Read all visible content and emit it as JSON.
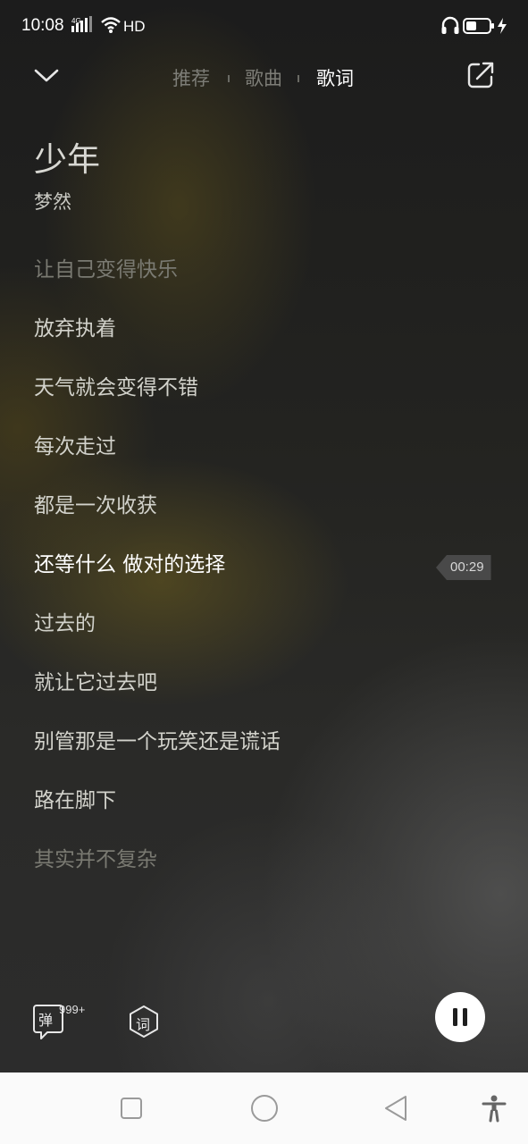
{
  "status_bar": {
    "time": "10:08",
    "network": "4G",
    "hd": "HD",
    "battery_level": 0.45,
    "icons": [
      "signal-icon",
      "wifi-icon",
      "headphone-icon",
      "battery-icon",
      "charging-icon"
    ]
  },
  "header": {
    "tabs": [
      {
        "label": "推荐",
        "active": false
      },
      {
        "label": "歌曲",
        "active": false
      },
      {
        "label": "歌词",
        "active": true
      }
    ],
    "icons": [
      "chevron-down-icon",
      "share-icon"
    ]
  },
  "song": {
    "title": "少年",
    "artist": "梦然"
  },
  "lyrics": {
    "lines": [
      {
        "text": "让自己变得快乐",
        "state": "dim"
      },
      {
        "text": "放弃执着",
        "state": "normal"
      },
      {
        "text": "天气就会变得不错",
        "state": "normal"
      },
      {
        "text": "每次走过",
        "state": "normal"
      },
      {
        "text": "都是一次收获",
        "state": "normal"
      },
      {
        "text": "还等什么 做对的选择",
        "state": "current"
      },
      {
        "text": "过去的",
        "state": "normal"
      },
      {
        "text": "就让它过去吧",
        "state": "normal"
      },
      {
        "text": "别管那是一个玩笑还是谎话",
        "state": "normal"
      },
      {
        "text": "路在脚下",
        "state": "normal"
      },
      {
        "text": "其实并不复杂",
        "state": "dim"
      }
    ],
    "current_time": "00:29"
  },
  "controls": {
    "danmu_label": "弹",
    "danmu_count": "999+",
    "lyric_mode_label": "词",
    "play_state": "playing",
    "icons": [
      "danmu-icon",
      "lyric-mode-icon",
      "pause-icon"
    ]
  },
  "nav_bar": {
    "icons": [
      "recent-apps-icon",
      "home-icon",
      "back-icon",
      "accessibility-icon"
    ]
  },
  "colors": {
    "current_line": "#ffffff",
    "normal_line": "#d2d2cb",
    "dim_line": "#7a7a72",
    "accent": "#ffffff"
  }
}
